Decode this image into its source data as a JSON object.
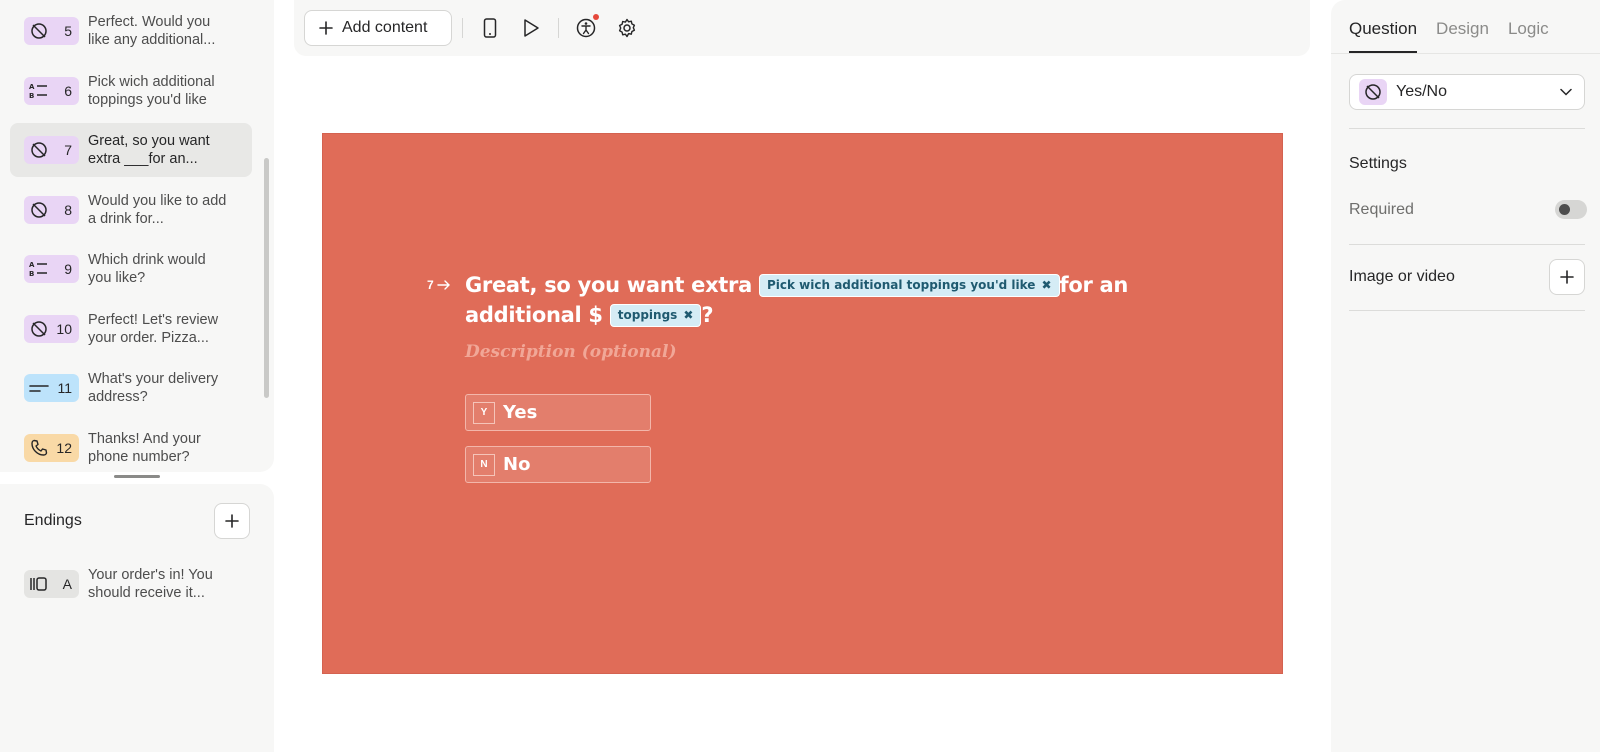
{
  "sidebar": {
    "questions": [
      {
        "num": "5",
        "text": "Perfect. Would you like any additional...",
        "icon": "yes-no-icon",
        "color": "purple"
      },
      {
        "num": "6",
        "text": "Pick wich additional toppings you'd like",
        "icon": "multiple-choice-icon",
        "color": "purple"
      },
      {
        "num": "7",
        "text": "Great, so you want extra ___for an...",
        "icon": "yes-no-icon",
        "color": "purple",
        "active": true
      },
      {
        "num": "8",
        "text": "Would you like to add a drink for...",
        "icon": "yes-no-icon",
        "color": "purple"
      },
      {
        "num": "9",
        "text": "Which drink would you like?",
        "icon": "multiple-choice-icon",
        "color": "purple"
      },
      {
        "num": "10",
        "text": "Perfect! Let's review your order. Pizza...",
        "icon": "yes-no-icon",
        "color": "purple"
      },
      {
        "num": "11",
        "text": "What's your delivery address?",
        "icon": "short-text-icon",
        "color": "blue"
      },
      {
        "num": "12",
        "text": "Thanks! And your phone number?",
        "icon": "phone-icon",
        "color": "orange"
      }
    ],
    "endings": {
      "title": "Endings",
      "items": [
        {
          "key": "A",
          "text": "Your order's in! You should receive it...",
          "icon": "ending-icon"
        }
      ]
    }
  },
  "toolbar": {
    "add_content_label": "Add content",
    "icons": [
      "mobile-preview-icon",
      "play-icon",
      "accessibility-icon",
      "settings-gear-icon"
    ]
  },
  "canvas": {
    "background_color": "#e06c58",
    "question_number": "7",
    "title_part1": "Great, so you want extra",
    "chip1": "Pick wich additional toppings you'd like",
    "title_part2": "for an additional $",
    "chip2": "toppings",
    "title_part3": "?",
    "description_placeholder": "Description (optional)",
    "choices": [
      {
        "key": "Y",
        "label": "Yes"
      },
      {
        "key": "N",
        "label": "No"
      }
    ]
  },
  "right_panel": {
    "tabs": [
      "Question",
      "Design",
      "Logic"
    ],
    "active_tab": "Question",
    "question_type": "Yes/No",
    "settings_title": "Settings",
    "required_label": "Required",
    "required_on": false,
    "media_label": "Image or video"
  }
}
